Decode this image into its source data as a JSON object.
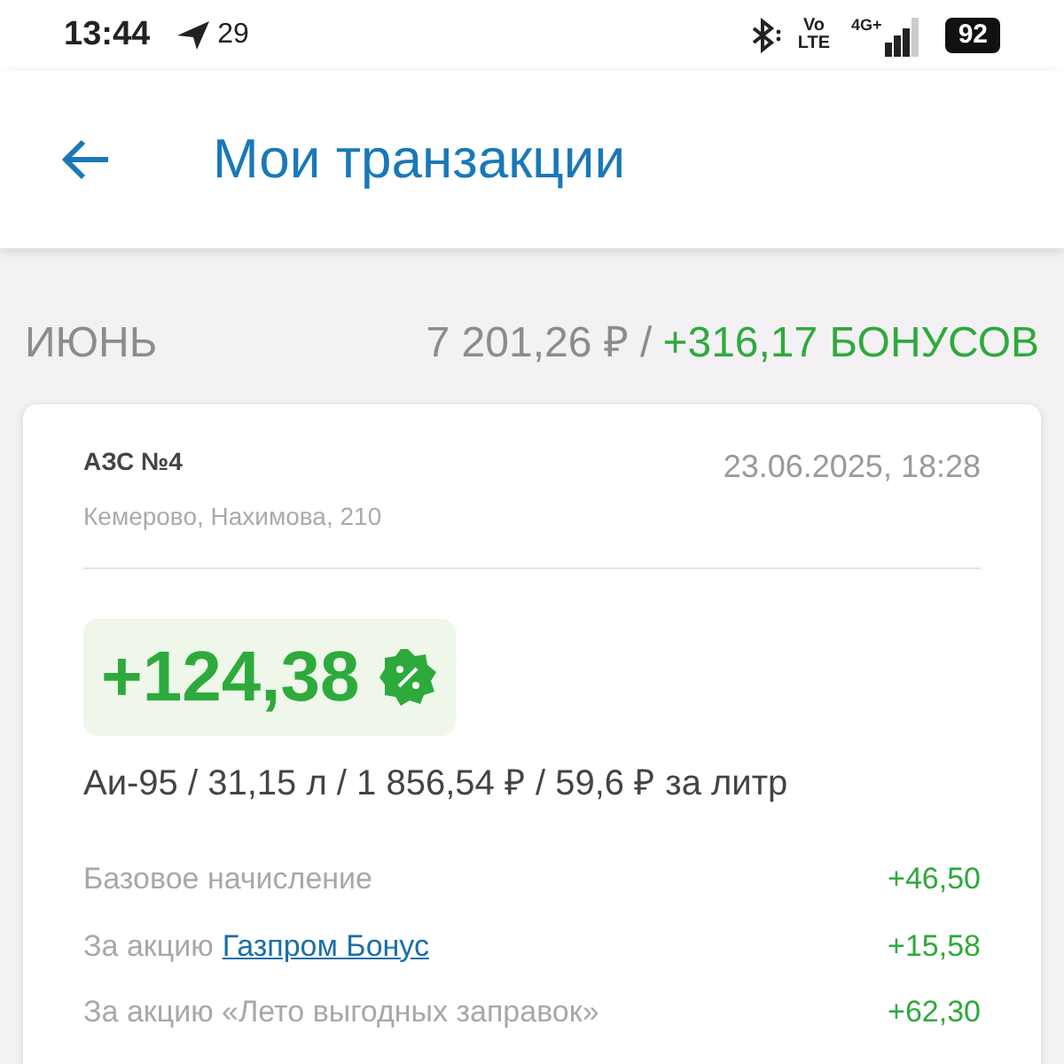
{
  "status_bar": {
    "time": "13:44",
    "temperature": "29",
    "volte": [
      "Vo",
      "LTE"
    ],
    "network": "4G+",
    "battery": "92"
  },
  "header": {
    "title": "Мои транзакции"
  },
  "month": {
    "name": "ИЮНЬ",
    "total": "7 201,26 ₽ /",
    "bonus": "+316,17 БОНУСОВ"
  },
  "transaction": {
    "station": "АЗС №4",
    "address": "Кемерово, Нахимова, 210",
    "datetime": "23.06.2025, 18:28",
    "bonus": "+124,38",
    "fuel": "Аи-95 / 31,15 л / 1 856,54 ₽ / 59,6 ₽ за литр",
    "accruals": [
      {
        "label": "Базовое начисление",
        "value": "+46,50"
      },
      {
        "label": "За акцию",
        "link": "Газпром Бонус",
        "value": "+15,58"
      },
      {
        "label": "За акцию «Лето выгодных заправок»",
        "value": "+62,30"
      }
    ]
  }
}
